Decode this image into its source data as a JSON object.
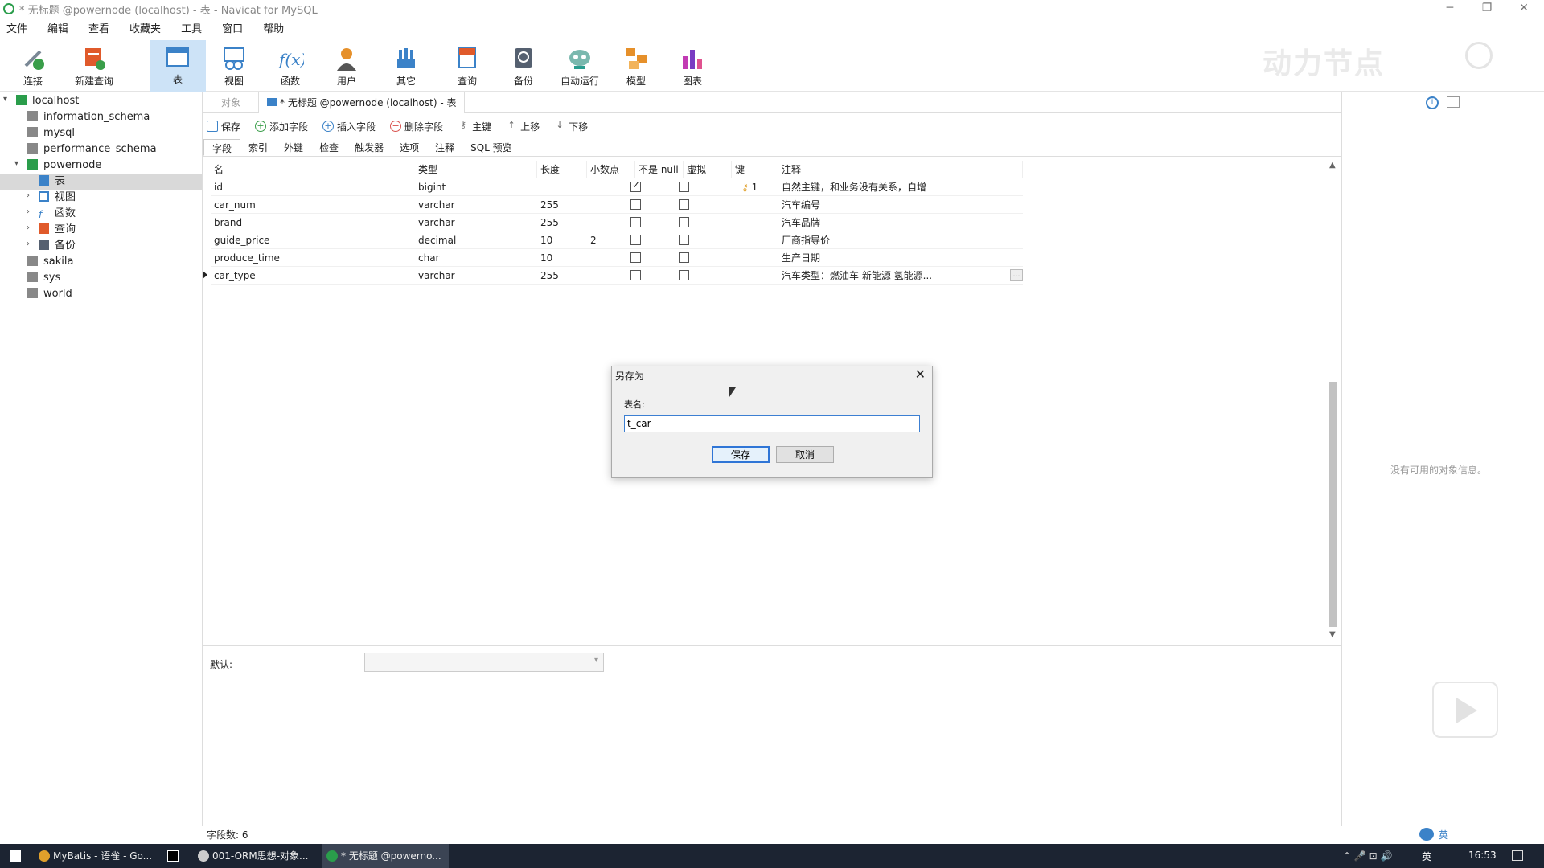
{
  "window": {
    "title": "* 无标题 @powernode (localhost) - 表 - Navicat for MySQL"
  },
  "menu": [
    "文件",
    "编辑",
    "查看",
    "收藏夹",
    "工具",
    "窗口",
    "帮助"
  ],
  "toolbar": [
    {
      "label": "连接",
      "icon": "connect-icon",
      "color": "#3a9e4a"
    },
    {
      "label": "新建查询",
      "icon": "new-query-icon",
      "color": "#e05a2b"
    },
    {
      "label": "表",
      "icon": "table-icon",
      "color": "#3b82c8"
    },
    {
      "label": "视图",
      "icon": "view-icon",
      "color": "#3b82c8"
    },
    {
      "label": "函数",
      "icon": "function-icon",
      "color": "#3b82c8"
    },
    {
      "label": "用户",
      "icon": "user-icon",
      "color": "#e6902a"
    },
    {
      "label": "其它",
      "icon": "other-icon",
      "color": "#3b82c8"
    },
    {
      "label": "查询",
      "icon": "query-icon",
      "color": "#e05a2b"
    },
    {
      "label": "备份",
      "icon": "backup-icon",
      "color": "#556070"
    },
    {
      "label": "自动运行",
      "icon": "auto-run-icon",
      "color": "#2a9d8f"
    },
    {
      "label": "模型",
      "icon": "model-icon",
      "color": "#e6902a"
    },
    {
      "label": "图表",
      "icon": "chart-icon",
      "color": "#c23bb4"
    }
  ],
  "watermark": "动力节点",
  "tree": {
    "connection": "localhost",
    "databases": [
      "information_schema",
      "mysql",
      "performance_schema",
      "powernode",
      "sakila",
      "sys",
      "world"
    ],
    "powernode_children": [
      "表",
      "视图",
      "函数",
      "查询",
      "备份"
    ]
  },
  "tabs": {
    "objects": "对象",
    "current": "* 无标题 @powernode (localhost) - 表"
  },
  "editor_toolbar": [
    "保存",
    "添加字段",
    "插入字段",
    "删除字段",
    "主键",
    "上移",
    "下移"
  ],
  "subtabs": [
    "字段",
    "索引",
    "外键",
    "检查",
    "触发器",
    "选项",
    "注释",
    "SQL 预览"
  ],
  "grid": {
    "headers": [
      "名",
      "类型",
      "长度",
      "小数点",
      "不是 null",
      "虚拟",
      "键",
      "注释"
    ],
    "rows": [
      {
        "name": "id",
        "type": "bigint",
        "length": "",
        "decimals": "",
        "notnull": true,
        "virtual": false,
        "key": "1",
        "comment": "自然主键，和业务没有关系，自增"
      },
      {
        "name": "car_num",
        "type": "varchar",
        "length": "255",
        "decimals": "",
        "notnull": false,
        "virtual": false,
        "key": "",
        "comment": "汽车编号"
      },
      {
        "name": "brand",
        "type": "varchar",
        "length": "255",
        "decimals": "",
        "notnull": false,
        "virtual": false,
        "key": "",
        "comment": "汽车品牌"
      },
      {
        "name": "guide_price",
        "type": "decimal",
        "length": "10",
        "decimals": "2",
        "notnull": false,
        "virtual": false,
        "key": "",
        "comment": "厂商指导价"
      },
      {
        "name": "produce_time",
        "type": "char",
        "length": "10",
        "decimals": "",
        "notnull": false,
        "virtual": false,
        "key": "",
        "comment": "生产日期"
      },
      {
        "name": "car_type",
        "type": "varchar",
        "length": "255",
        "decimals": "",
        "notnull": false,
        "virtual": false,
        "key": "",
        "comment": "汽车类型：燃油车 新能源 氢能源..."
      }
    ]
  },
  "bottom": {
    "default_label": "默认:"
  },
  "rightpane": {
    "info": "没有可用的对象信息。"
  },
  "status": {
    "field_count": "字段数: 6"
  },
  "dialog": {
    "title": "另存为",
    "label": "表名:",
    "value": "t_car",
    "save": "保存",
    "cancel": "取消"
  },
  "taskbar": {
    "items": [
      "MyBatis - 语雀 - Go...",
      "001-ORM思想-对象...",
      "* 无标题 @powerno..."
    ],
    "clock": "16:53",
    "lang": "英"
  }
}
